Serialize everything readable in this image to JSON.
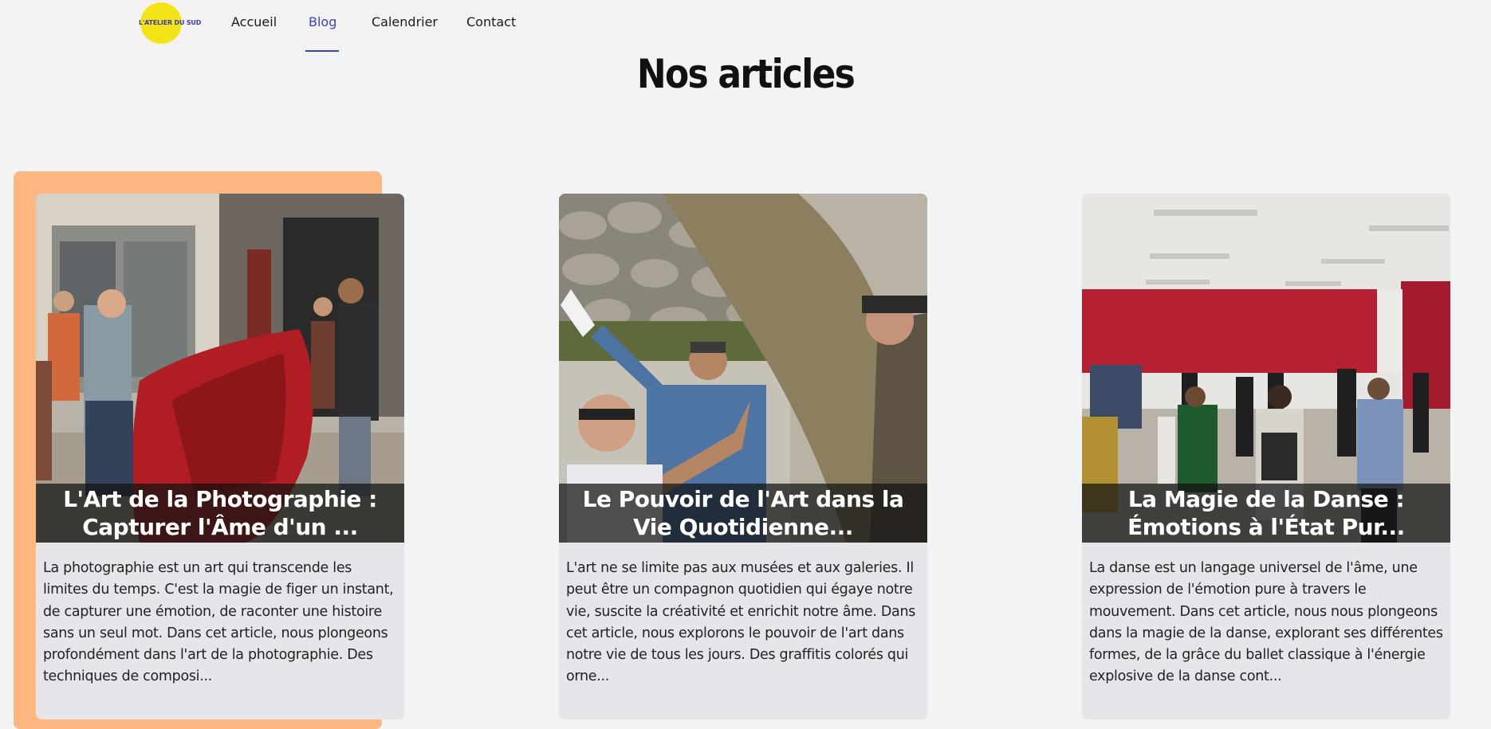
{
  "nav": {
    "logo_text": "L'ATELIER DU SUD",
    "items": [
      {
        "label": "Accueil"
      },
      {
        "label": "Blog"
      },
      {
        "label": "Calendrier"
      },
      {
        "label": "Contact"
      }
    ],
    "active_color": "#3a46b8"
  },
  "page": {
    "title": "Nos articles"
  },
  "articles": [
    {
      "title": "L'Art de la Photographie : Capturer l'Âme d'un ...",
      "excerpt": "La photographie est un art qui transcende les limites du temps. C'est la magie de figer un instant, de capturer une émotion, de raconter une histoire sans un seul mot. Dans cet article, nous plongeons profondément dans l'art de la photographie. Des techniques de composi..."
    },
    {
      "title": "Le Pouvoir de l'Art dans la Vie Quotidienne...",
      "excerpt": "L'art ne se limite pas aux musées et aux galeries. Il peut être un compagnon quotidien qui égaye notre vie, suscite la créativité et enrichit notre âme. Dans cet article, nous explorons le pouvoir de l'art dans notre vie de tous les jours. Des graffitis colorés qui orne..."
    },
    {
      "title": "La Magie de la Danse : Émotions à l'État Pur...",
      "excerpt": "La danse est un langage universel de l'âme, une expression de l'émotion pure à travers le mouvement. Dans cet article, nous nous plongeons dans la magie de la danse, explorant ses différentes formes, de la grâce du ballet classique à l'énergie explosive de la danse cont..."
    }
  ],
  "colors": {
    "accent_orange": "#ffb782",
    "card_bg": "#e5e6ea",
    "page_bg": "#f2f3f5"
  }
}
